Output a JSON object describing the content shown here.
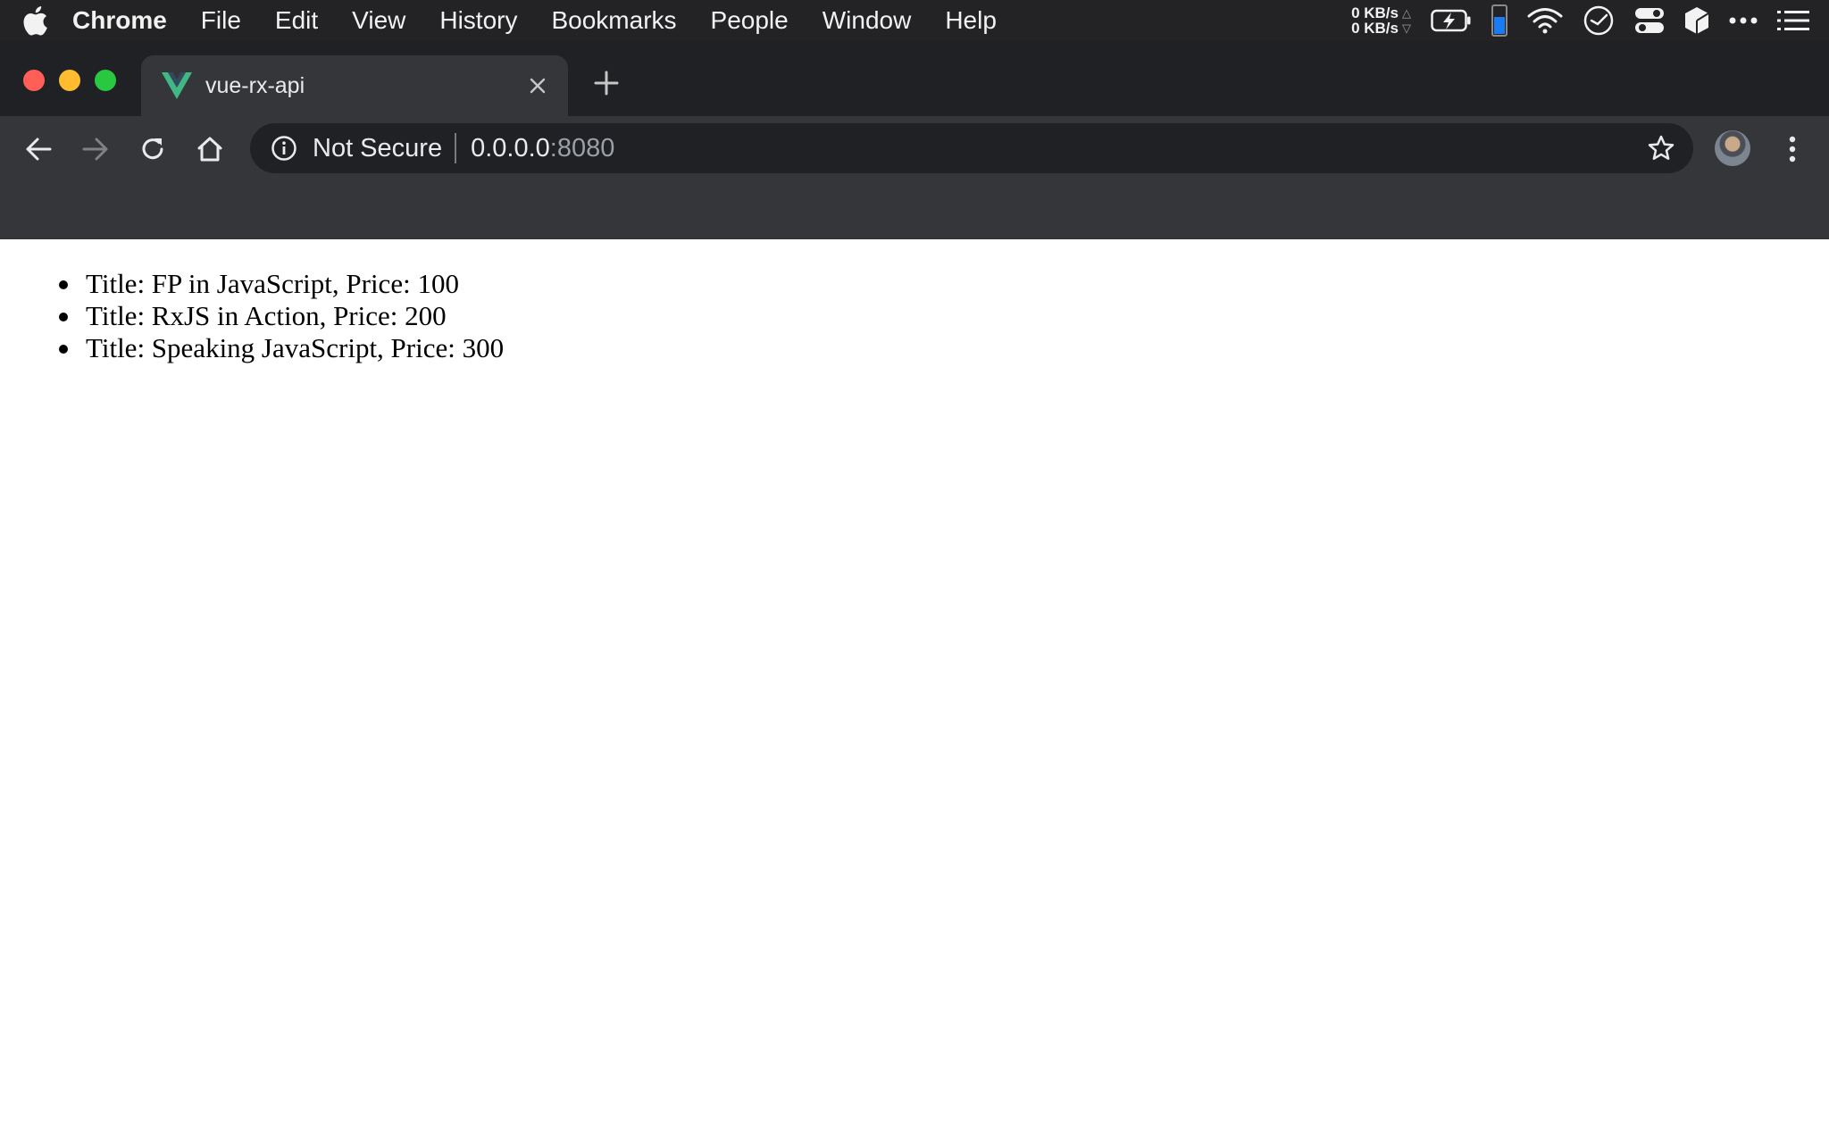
{
  "menubar": {
    "app_name": "Chrome",
    "items": [
      "File",
      "Edit",
      "View",
      "History",
      "Bookmarks",
      "People",
      "Window",
      "Help"
    ],
    "status": {
      "upload_rate": "0 KB/s",
      "download_rate": "0 KB/s",
      "icons": [
        "battery-charging-icon",
        "battery-level-icon",
        "wifi-icon",
        "clock-icon",
        "control-center-icon",
        "cube-icon",
        "more-icon",
        "list-icon"
      ]
    }
  },
  "browser": {
    "tab": {
      "title": "vue-rx-api",
      "favicon": "vue-logo-icon",
      "favicon_color": "#41b883"
    },
    "omnibox": {
      "security_label": "Not Secure",
      "host": "0.0.0.0",
      "port": ":8080"
    },
    "colors": {
      "tabstrip": "#202124",
      "toolbar": "#35363a",
      "traffic_close": "#ff5f57",
      "traffic_minimize": "#febc2e",
      "traffic_zoom": "#28c840"
    }
  },
  "page": {
    "books": [
      "Title: FP in JavaScript, Price: 100",
      "Title: RxJS in Action, Price: 200",
      "Title: Speaking JavaScript, Price: 300"
    ]
  }
}
